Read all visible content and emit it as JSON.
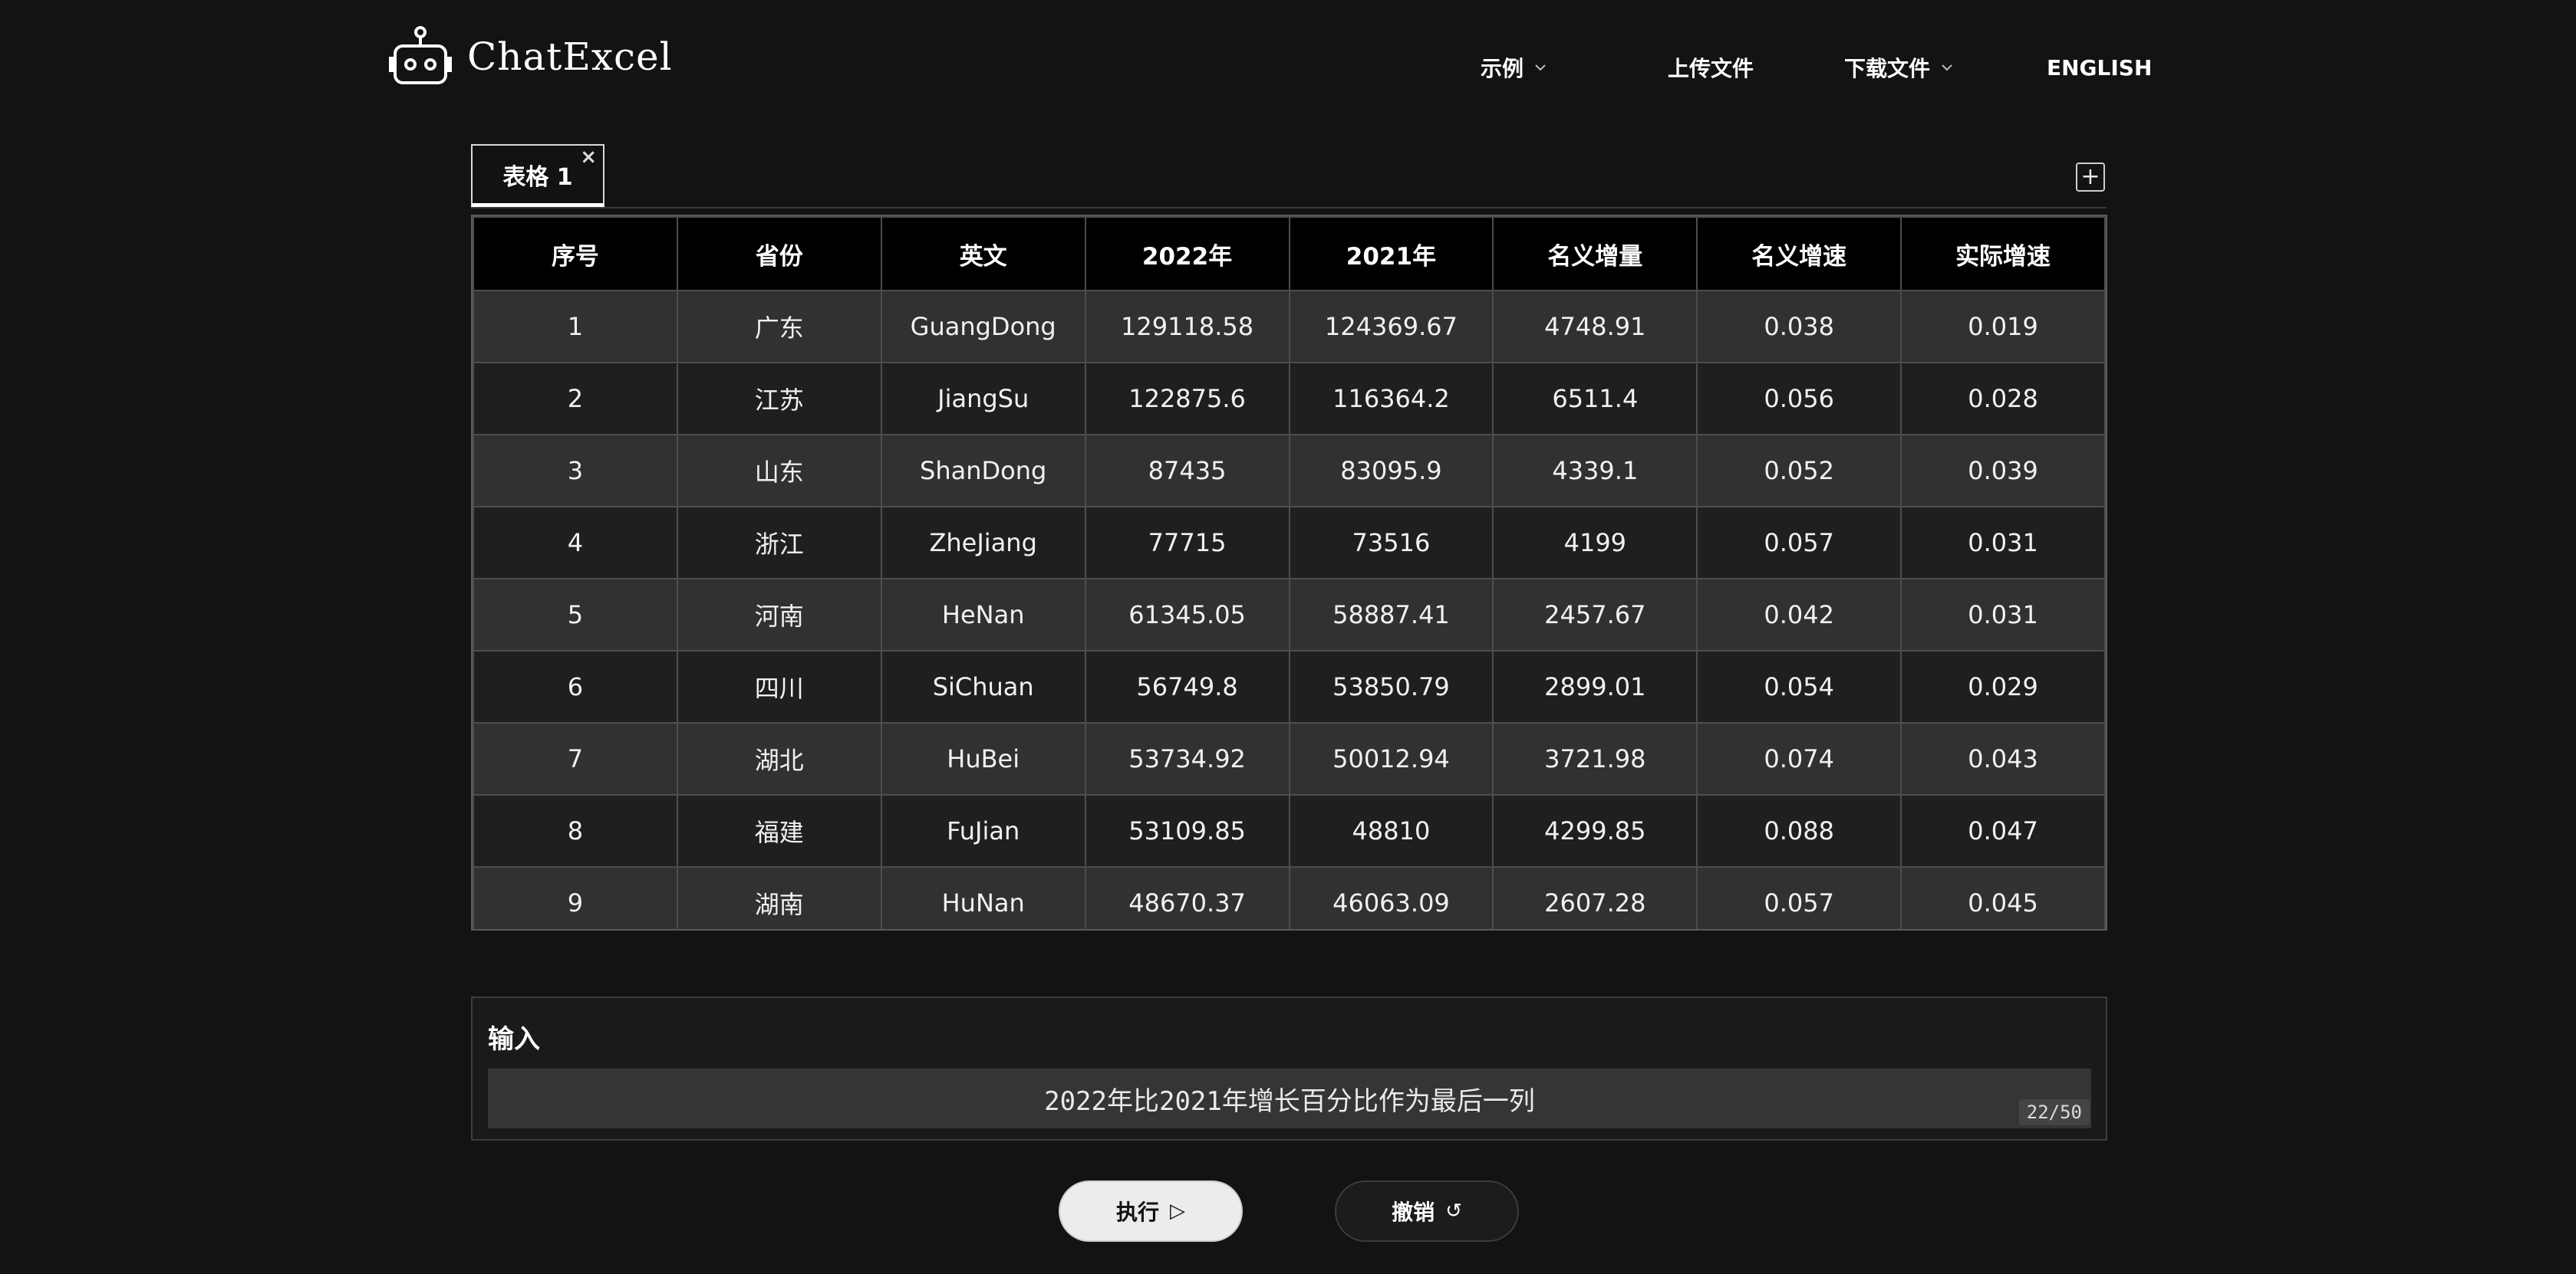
{
  "header": {
    "logo_text": "ChatExcel",
    "nav": {
      "examples": "示例",
      "upload": "上传文件",
      "download": "下载文件",
      "language": "ENGLISH"
    }
  },
  "tabs": [
    {
      "label": "表格 1",
      "close": "×"
    }
  ],
  "add_tab_symbol": "+",
  "table": {
    "headers": [
      "序号",
      "省份",
      "英文",
      "2022年",
      "2021年",
      "名义增量",
      "名义增速",
      "实际增速"
    ],
    "rows": [
      [
        "1",
        "广东",
        "GuangDong",
        "129118.58",
        "124369.67",
        "4748.91",
        "0.038",
        "0.019"
      ],
      [
        "2",
        "江苏",
        "JiangSu",
        "122875.6",
        "116364.2",
        "6511.4",
        "0.056",
        "0.028"
      ],
      [
        "3",
        "山东",
        "ShanDong",
        "87435",
        "83095.9",
        "4339.1",
        "0.052",
        "0.039"
      ],
      [
        "4",
        "浙江",
        "ZheJiang",
        "77715",
        "73516",
        "4199",
        "0.057",
        "0.031"
      ],
      [
        "5",
        "河南",
        "HeNan",
        "61345.05",
        "58887.41",
        "2457.67",
        "0.042",
        "0.031"
      ],
      [
        "6",
        "四川",
        "SiChuan",
        "56749.8",
        "53850.79",
        "2899.01",
        "0.054",
        "0.029"
      ],
      [
        "7",
        "湖北",
        "HuBei",
        "53734.92",
        "50012.94",
        "3721.98",
        "0.074",
        "0.043"
      ],
      [
        "8",
        "福建",
        "FuJian",
        "53109.85",
        "48810",
        "4299.85",
        "0.088",
        "0.047"
      ],
      [
        "9",
        "湖南",
        "HuNan",
        "48670.37",
        "46063.09",
        "2607.28",
        "0.057",
        "0.045"
      ]
    ]
  },
  "input": {
    "label": "输入",
    "value": "2022年比2021年增长百分比作为最后一列",
    "counter": "22/50"
  },
  "buttons": {
    "run": "执行",
    "run_icon": "▷",
    "undo": "撤销",
    "undo_icon": "↺"
  }
}
